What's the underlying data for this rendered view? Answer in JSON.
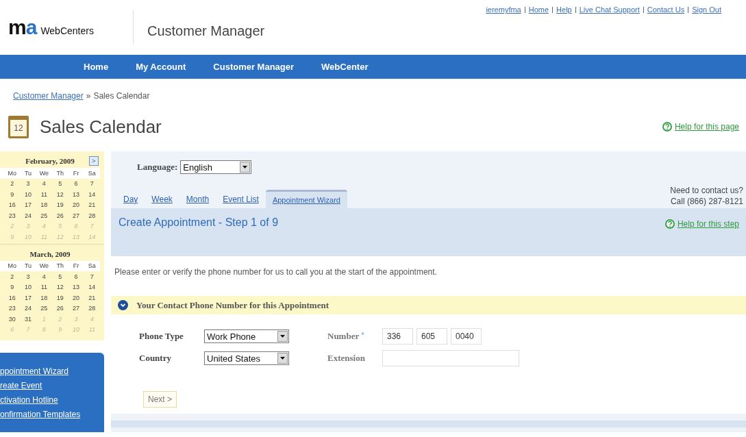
{
  "header": {
    "logo_parts": [
      "m",
      "a"
    ],
    "logo_name": "WebCenters",
    "app_title": "Customer Manager",
    "top_links": [
      "ieremyfma",
      "Home",
      "Help",
      "Live Chat Support",
      "Contact Us",
      "Sign Out"
    ]
  },
  "nav": [
    "Home",
    "My Account",
    "Customer Manager",
    "WebCenter"
  ],
  "breadcrumb": {
    "link": "Customer Manager",
    "sep": "»",
    "current": "Sales Calendar"
  },
  "page_title": "Sales Calendar",
  "calendar_icon_text": "12",
  "help_page": "Help for this page",
  "calendars": [
    {
      "title": "February, 2009",
      "next_button": ">",
      "weekdays": [
        "Mo",
        "Tu",
        "We",
        "Th",
        "Fr",
        "Sa"
      ],
      "weeks": [
        [
          {
            "d": "2",
            "muted": false
          },
          {
            "d": "3",
            "muted": false
          },
          {
            "d": "4",
            "muted": false
          },
          {
            "d": "5",
            "muted": false
          },
          {
            "d": "6",
            "muted": false
          },
          {
            "d": "7",
            "muted": false
          }
        ],
        [
          {
            "d": "9",
            "muted": false
          },
          {
            "d": "10",
            "muted": false
          },
          {
            "d": "11",
            "muted": false
          },
          {
            "d": "12",
            "muted": false
          },
          {
            "d": "13",
            "muted": false
          },
          {
            "d": "14",
            "muted": false
          }
        ],
        [
          {
            "d": "16",
            "muted": false
          },
          {
            "d": "17",
            "muted": false
          },
          {
            "d": "18",
            "muted": false
          },
          {
            "d": "19",
            "muted": false
          },
          {
            "d": "20",
            "muted": false
          },
          {
            "d": "21",
            "muted": false
          }
        ],
        [
          {
            "d": "23",
            "muted": false
          },
          {
            "d": "24",
            "muted": false
          },
          {
            "d": "25",
            "muted": false
          },
          {
            "d": "26",
            "muted": false
          },
          {
            "d": "27",
            "muted": false
          },
          {
            "d": "28",
            "muted": false
          }
        ],
        [
          {
            "d": "2",
            "muted": true
          },
          {
            "d": "3",
            "muted": true
          },
          {
            "d": "4",
            "muted": true
          },
          {
            "d": "5",
            "muted": true
          },
          {
            "d": "6",
            "muted": true
          },
          {
            "d": "7",
            "muted": true
          }
        ],
        [
          {
            "d": "9",
            "muted": true
          },
          {
            "d": "10",
            "muted": true
          },
          {
            "d": "11",
            "muted": true
          },
          {
            "d": "12",
            "muted": true
          },
          {
            "d": "13",
            "muted": true
          },
          {
            "d": "14",
            "muted": true
          }
        ]
      ]
    },
    {
      "title": "March, 2009",
      "weekdays": [
        "Mo",
        "Tu",
        "We",
        "Th",
        "Fr",
        "Sa"
      ],
      "weeks": [
        [
          {
            "d": "2",
            "muted": false
          },
          {
            "d": "3",
            "muted": false
          },
          {
            "d": "4",
            "muted": false
          },
          {
            "d": "5",
            "muted": false
          },
          {
            "d": "6",
            "muted": false
          },
          {
            "d": "7",
            "muted": false
          }
        ],
        [
          {
            "d": "9",
            "muted": false
          },
          {
            "d": "10",
            "muted": false
          },
          {
            "d": "11",
            "muted": false
          },
          {
            "d": "12",
            "muted": false
          },
          {
            "d": "13",
            "muted": false
          },
          {
            "d": "14",
            "muted": false
          }
        ],
        [
          {
            "d": "16",
            "muted": false
          },
          {
            "d": "17",
            "muted": false
          },
          {
            "d": "18",
            "muted": false
          },
          {
            "d": "19",
            "muted": false
          },
          {
            "d": "20",
            "muted": false
          },
          {
            "d": "21",
            "muted": false
          }
        ],
        [
          {
            "d": "23",
            "muted": false
          },
          {
            "d": "24",
            "muted": false
          },
          {
            "d": "25",
            "muted": false
          },
          {
            "d": "26",
            "muted": false
          },
          {
            "d": "27",
            "muted": false
          },
          {
            "d": "28",
            "muted": false
          }
        ],
        [
          {
            "d": "30",
            "muted": false
          },
          {
            "d": "31",
            "muted": false
          },
          {
            "d": "1",
            "muted": true
          },
          {
            "d": "2",
            "muted": true
          },
          {
            "d": "3",
            "muted": true
          },
          {
            "d": "4",
            "muted": true
          }
        ],
        [
          {
            "d": "6",
            "muted": true
          },
          {
            "d": "7",
            "muted": true
          },
          {
            "d": "8",
            "muted": true
          },
          {
            "d": "9",
            "muted": true
          },
          {
            "d": "10",
            "muted": true
          },
          {
            "d": "11",
            "muted": true
          }
        ]
      ]
    }
  ],
  "sidebar_links": [
    "ppointment Wizard",
    "reate Event",
    "ctivation Hotline",
    "onfirmation Templates"
  ],
  "language": {
    "label": "Language:",
    "value": "English"
  },
  "tabs": [
    {
      "label": "Day",
      "selected": false
    },
    {
      "label": "Week",
      "selected": false
    },
    {
      "label": "Month",
      "selected": false
    },
    {
      "label": "Event List",
      "selected": false
    },
    {
      "label": "Appointment Wizard",
      "selected": true
    }
  ],
  "contact": [
    "Need to contact us?",
    "Call (866) 287-8121"
  ],
  "step_title": "Create Appointment - Step 1 of 9",
  "help_step": "Help for this step",
  "instruction": "Please enter or verify the phone number for us to call you at the start of the appointment.",
  "section_title": "Your Contact Phone Number for this Appointment",
  "form": {
    "phone_type": {
      "label": "Phone Type",
      "value": "Work Phone"
    },
    "country": {
      "label": "Country",
      "value": "United States"
    },
    "number": {
      "label": "Number",
      "required": "*",
      "parts": [
        "336",
        "605",
        "0040"
      ]
    },
    "extension": {
      "label": "Extension"
    }
  },
  "next_button": "Next >"
}
